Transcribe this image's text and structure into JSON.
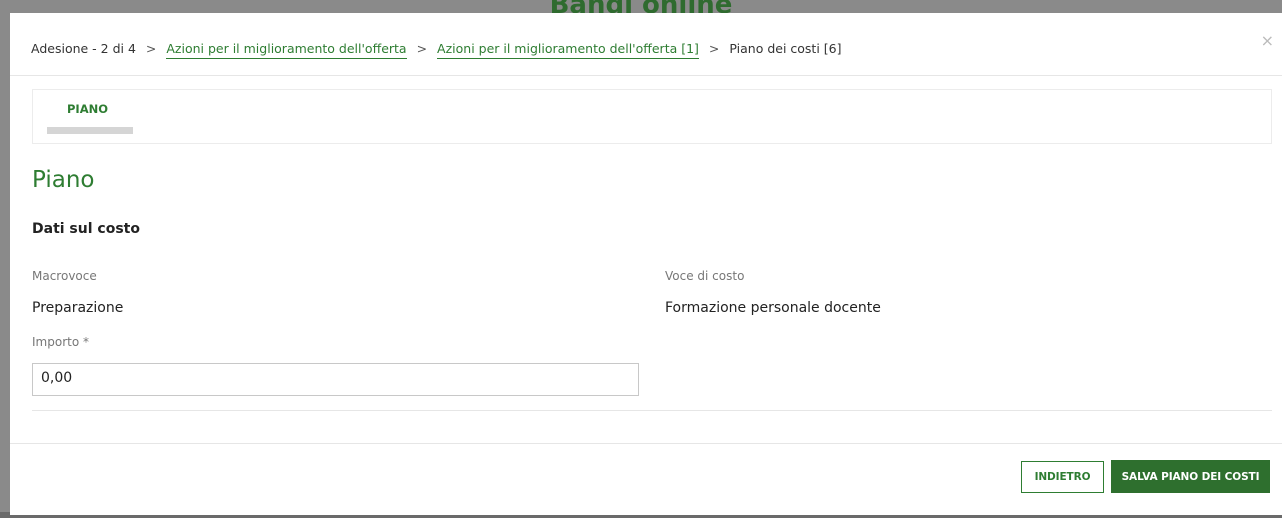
{
  "background": {
    "title": "Bandi online"
  },
  "breadcrumb": {
    "step": "Adesione - 2 di 4",
    "items": [
      "Azioni per il miglioramento dell'offerta",
      "Azioni per il miglioramento dell'offerta [1]"
    ],
    "current": "Piano dei costi [6]",
    "separator": ">"
  },
  "close_icon": "×",
  "tabs": [
    {
      "label": "PIANO"
    }
  ],
  "section": {
    "title": "Piano",
    "subtitle": "Dati sul costo"
  },
  "fields": {
    "macrovoce": {
      "label": "Macrovoce",
      "value": "Preparazione"
    },
    "voce": {
      "label": "Voce di costo",
      "value": "Formazione personale docente"
    },
    "importo": {
      "label": "Importo *",
      "value": "0,00"
    }
  },
  "footer": {
    "back_label": "INDIETRO",
    "save_label": "SALVA PIANO DEI COSTI"
  },
  "colors": {
    "accent": "#2e7d32",
    "button_primary": "#2e6f2e",
    "overlay": "#8a8a8a"
  }
}
